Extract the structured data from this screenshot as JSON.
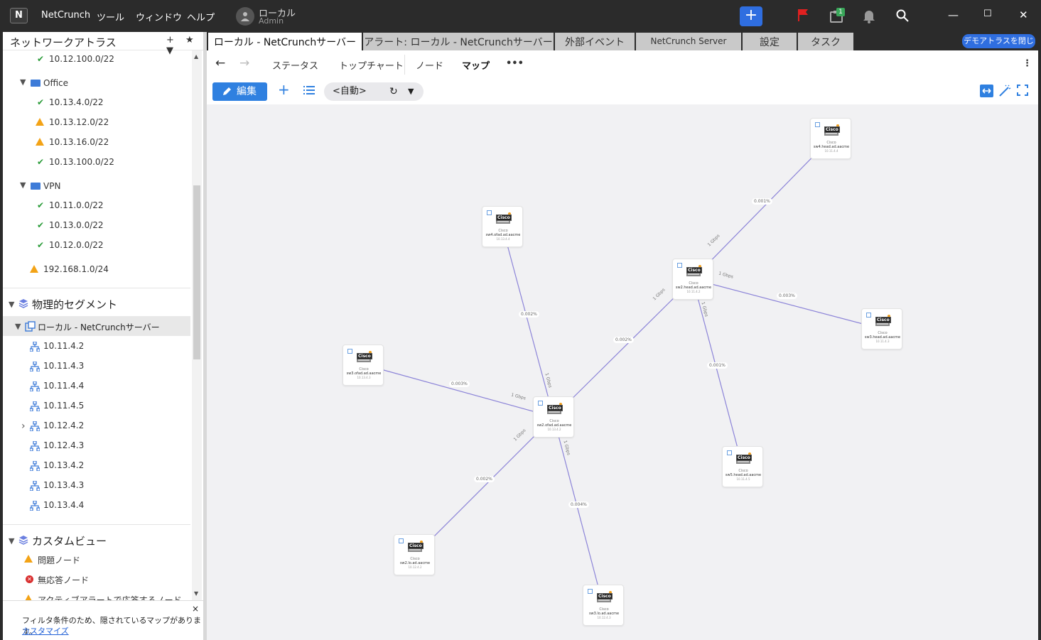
{
  "app": {
    "logo": "N",
    "name": "NetCrunch"
  },
  "menu": [
    "NetCrunch",
    "ツール",
    "ウィンドウ",
    "ヘルプ"
  ],
  "user": {
    "name": "ローカル",
    "role": "Admin"
  },
  "titlebar": {
    "notifications_badge": "1",
    "accent_color": "#2f6ee0",
    "flag_color": "#e02020"
  },
  "sidebar": {
    "title": "ネットワークアトラス",
    "tools": "+ ★ ▼",
    "items": [
      {
        "label": "10.12.100.0/22",
        "status": "ok"
      },
      {
        "label": "Office",
        "type": "folder"
      },
      {
        "label": "10.13.4.0/22",
        "status": "ok"
      },
      {
        "label": "10.13.12.0/22",
        "status": "warning"
      },
      {
        "label": "10.13.16.0/22",
        "status": "warning"
      },
      {
        "label": "10.13.100.0/22",
        "status": "ok"
      },
      {
        "label": "VPN",
        "type": "folder"
      },
      {
        "label": "10.11.0.0/22",
        "status": "ok"
      },
      {
        "label": "10.13.0.0/22",
        "status": "ok"
      },
      {
        "label": "10.12.0.0/22",
        "status": "ok"
      },
      {
        "label": "192.168.1.0/24",
        "status": "warning"
      }
    ],
    "physical_section": "物理的セグメント",
    "local_server": "ローカル - NetCrunchサーバー",
    "segments": [
      "10.11.4.2",
      "10.11.4.3",
      "10.11.4.4",
      "10.11.4.5",
      "10.12.4.2",
      "10.12.4.3",
      "10.13.4.2",
      "10.13.4.3",
      "10.13.4.4"
    ],
    "custom_section": "カスタムビュー",
    "custom_items": [
      {
        "label": "問題ノード",
        "status": "warning"
      },
      {
        "label": "無応答ノード",
        "status": "error"
      },
      {
        "label": "アクティブアラートで応答するノード",
        "status": "warning"
      }
    ],
    "notice": {
      "text": "フィルタ条件のため、隠されているマップがあります。",
      "link": "カスタマイズ",
      "close": "×"
    }
  },
  "tabs": [
    {
      "label": "ローカル - NetCrunchサーバー",
      "active": true
    },
    {
      "label": "アラート: ローカル - NetCrunchサーバー"
    },
    {
      "label": "外部イベント"
    },
    {
      "label": "NetCrunch Server"
    },
    {
      "label": "設定"
    },
    {
      "label": "タスク"
    }
  ],
  "close_atlas_button": "デモアトラスを閉じる",
  "view_nav": {
    "items": [
      "ステータス",
      "トップチャート",
      "ノード",
      "マップ"
    ],
    "active": "マップ",
    "more": "•••"
  },
  "toolbar": {
    "edit_label": "編集",
    "layout_select": "<自動>"
  },
  "map": {
    "line_color": "#8c84d8",
    "nodes": [
      {
        "id": "sw4-head",
        "vendor": "Cisco",
        "name": "sw4.head.ad.aacme",
        "ip": "10.11.4.4"
      },
      {
        "id": "sw4-ofad",
        "vendor": "Cisco",
        "name": "sw4.ofad.ad.aacme",
        "ip": "10.13.4.4"
      },
      {
        "id": "sw2-head",
        "vendor": "Cisco",
        "name": "sw2.head.ad.aacme",
        "ip": "10.11.4.2"
      },
      {
        "id": "sw3-head",
        "vendor": "Cisco",
        "name": "sw3.head.ad.aacme",
        "ip": "10.11.4.3"
      },
      {
        "id": "sw3-ofad",
        "vendor": "Cisco",
        "name": "sw3.ofad.ad.aacme",
        "ip": "10.13.4.3"
      },
      {
        "id": "sw2-ofad",
        "vendor": "Cisco",
        "name": "sw2.ofad.ad.aacme",
        "ip": "10.13.4.2"
      },
      {
        "id": "sw5-head",
        "vendor": "Cisco",
        "name": "sw5.head.ad.aacme",
        "ip": "10.11.4.5"
      },
      {
        "id": "sw2-lo",
        "vendor": "Cisco",
        "name": "sw2.lo.ad.aacme",
        "ip": "10.12.4.2"
      },
      {
        "id": "sw3-lo",
        "vendor": "Cisco",
        "name": "sw3.lo.ad.aacme",
        "ip": "10.12.4.3"
      }
    ],
    "links": [
      {
        "util": "0.001%",
        "speed": "1 Gbps"
      },
      {
        "util": "0.003%",
        "speed": "1 Gbps"
      },
      {
        "util": "0.001%",
        "speed": "1 Gbps"
      },
      {
        "util": "0.002%",
        "speed": "1 Gbps"
      },
      {
        "util": "0.002%",
        "speed": "1 Gbps"
      },
      {
        "util": "0.003%",
        "speed": "1 Gbps"
      },
      {
        "util": "0.002%",
        "speed": "1 Gbps"
      },
      {
        "util": "0.004%",
        "speed": "1 Gbps"
      }
    ]
  }
}
